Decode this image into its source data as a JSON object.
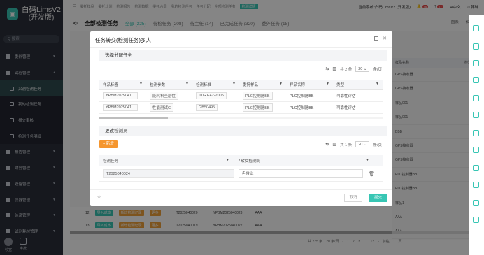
{
  "app": {
    "title": "白码LimsV2",
    "subtitle": "(开发版)"
  },
  "sidebar": {
    "search_placeholder": "Q 搜索",
    "items": [
      {
        "label": "委外管理"
      },
      {
        "label": "试验管理"
      },
      {
        "label": "采测检测任务"
      },
      {
        "label": "我的检测任务"
      },
      {
        "label": "报交审核"
      },
      {
        "label": "检测任务明细"
      },
      {
        "label": "报告管理"
      },
      {
        "label": "财务管理"
      },
      {
        "label": "设备管理"
      },
      {
        "label": "仪器管理"
      },
      {
        "label": "体系管理"
      },
      {
        "label": "试剂耗材管理"
      }
    ],
    "bottom": [
      {
        "label": "衫宽"
      },
      {
        "label": "审批"
      }
    ]
  },
  "topbar": {
    "tabs": [
      "委托样品",
      "委托计划",
      "检测报告",
      "检测数据",
      "委托合同",
      "我的检测任务",
      "任务分配",
      "全部检测任务",
      "检测详情"
    ],
    "env": "当前系统:白码LimsV2 (开发版)",
    "badges": [
      "46",
      "77"
    ],
    "lang": "中文",
    "user": "韩玮"
  },
  "subheader": {
    "back": "⟲",
    "title": "全部检测任务",
    "statuses": [
      {
        "label": "全部 (225)"
      },
      {
        "label": "待检任务 (208)"
      },
      {
        "label": "待主任 (14)"
      },
      {
        "label": "已完成任务 (320)"
      },
      {
        "label": "委外任务 (18)"
      }
    ],
    "right": [
      "图表",
      "仪(0)"
    ]
  },
  "background": {
    "right_column_header": "样品名称",
    "right_column_header2": "检测附",
    "right_column": [
      "GPS接收器",
      "GPS接收器",
      "样品001",
      "样品001",
      "BBB",
      "GPS接收器",
      "GPS接收器",
      "PLC控制器BB",
      "PLC控制器BB",
      "样品1",
      "AAA",
      "AAA"
    ],
    "rows": [
      {
        "no": "12",
        "code": "T2025040020",
        "sample": "YPBM2025040023",
        "name": "AAA"
      },
      {
        "no": "13",
        "code": "T2025040019",
        "sample": "YPBM2025040022",
        "name": "AAA"
      }
    ],
    "row_actions": [
      "导入成本",
      "新增检测记录",
      "更多"
    ],
    "pager": {
      "total": "共 225 条",
      "size": "20 条/页",
      "pages": "12",
      "goto": "前往",
      "goto_page": "1",
      "page_unit": "页"
    }
  },
  "modal": {
    "title": "任务转交(检测任务)多人",
    "section1": {
      "title": "选择分配任务",
      "pager": {
        "total": "共 2 条",
        "size": "20",
        "unit": "条/页"
      },
      "columns": [
        "样品标签",
        "检测参数",
        "检测标准",
        "委托样品",
        "样品名称",
        "类型"
      ],
      "rows": [
        {
          "label": "YPBM2025041...",
          "param": "能耗科至层性",
          "std": "JTG E42-2005",
          "sample": "PLC控制器BB",
          "name": "PLC控制器BB",
          "type": "可靠性评估"
        },
        {
          "label": "YPBM2025041...",
          "param": "性能测试C",
          "std": "GB50495",
          "sample": "PLC控制器BB",
          "name": "PLC控制器BB",
          "type": "可靠性评估"
        }
      ]
    },
    "section2": {
      "title": "更改检测员",
      "add_label": "+ 新增",
      "pager": {
        "total": "共 1 条",
        "size": "20",
        "unit": "条/页"
      },
      "columns": [
        "检测任务",
        "* 转交检测员"
      ],
      "rows": [
        {
          "task": "T2025040024",
          "person": "冉俊业"
        }
      ]
    },
    "footer": {
      "cancel": "取消",
      "submit": "提交"
    }
  }
}
